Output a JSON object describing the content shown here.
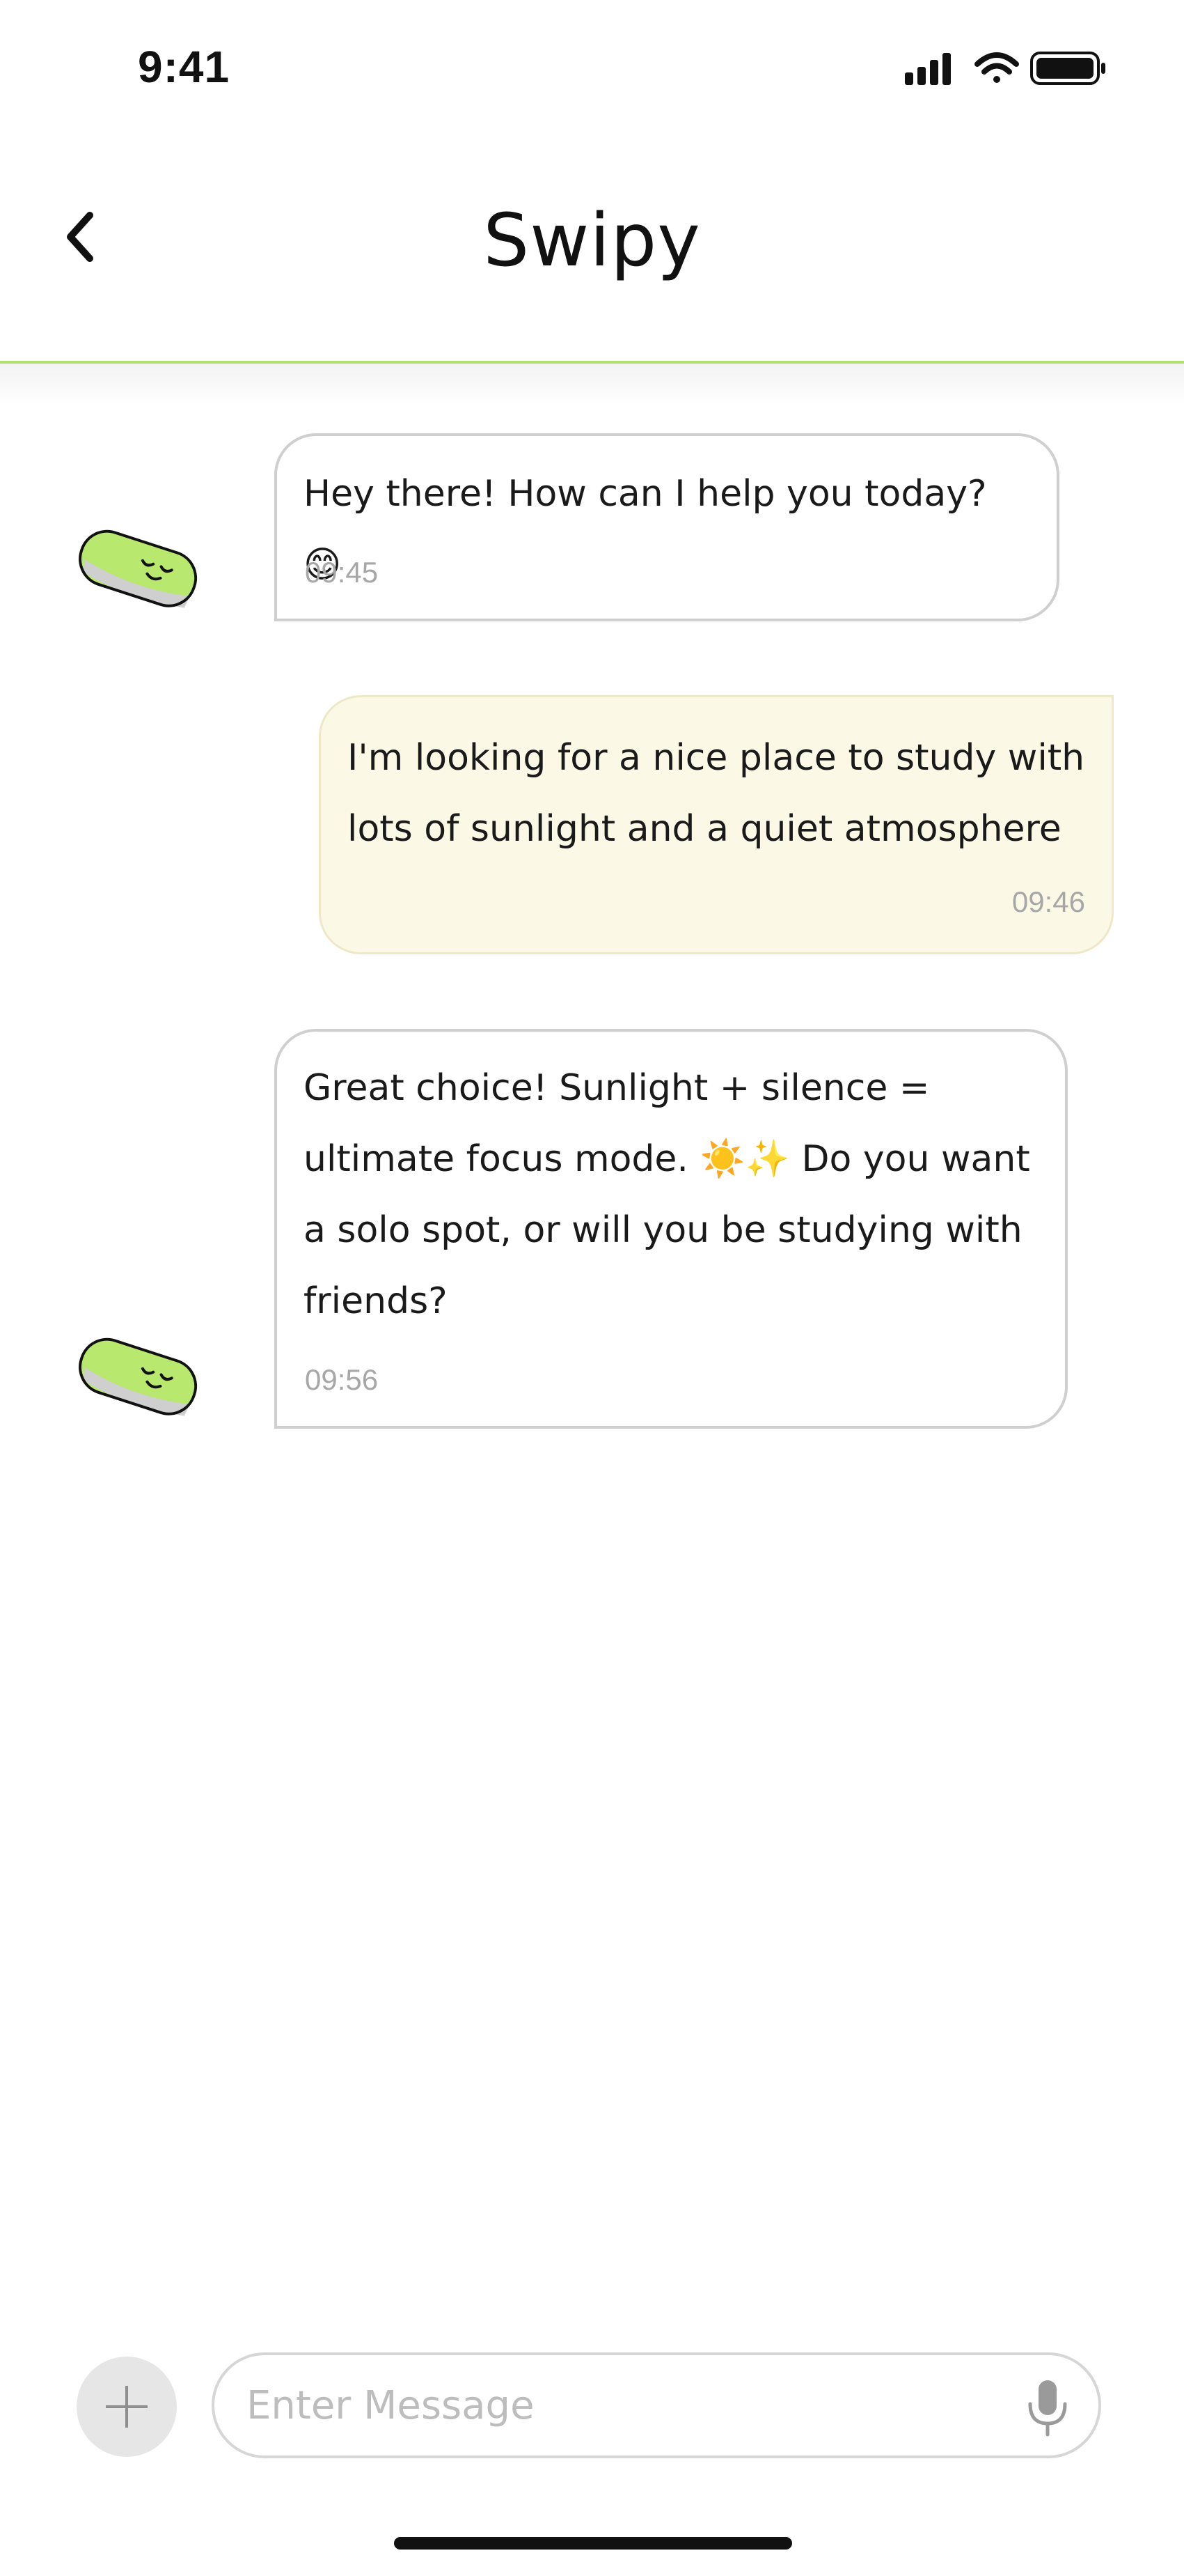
{
  "status_bar": {
    "time": "9:41"
  },
  "header": {
    "title": "Swipy"
  },
  "messages": [
    {
      "sender": "bot",
      "text": "Hey there! How can I help you today? 😊",
      "time": "09:45"
    },
    {
      "sender": "user",
      "text": "I'm looking for a nice place to study with lots of sunlight and a quiet atmosphere",
      "time": "09:46"
    },
    {
      "sender": "bot",
      "text": "Great choice! Sunlight + silence = ultimate focus mode. ☀️✨ Do you want a solo spot, or will you be studying with friends?",
      "time": "09:56"
    }
  ],
  "composer": {
    "placeholder": "Enter Message"
  },
  "colors": {
    "accent": "#b2e071",
    "user_bubble": "#fcf8e6",
    "bot_border": "#cfcfcf",
    "mascot": "#b9e86f"
  },
  "icons": [
    "back-chevron-icon",
    "signal-icon",
    "wifi-icon",
    "battery-icon",
    "plus-icon",
    "microphone-icon",
    "mascot-avatar"
  ]
}
